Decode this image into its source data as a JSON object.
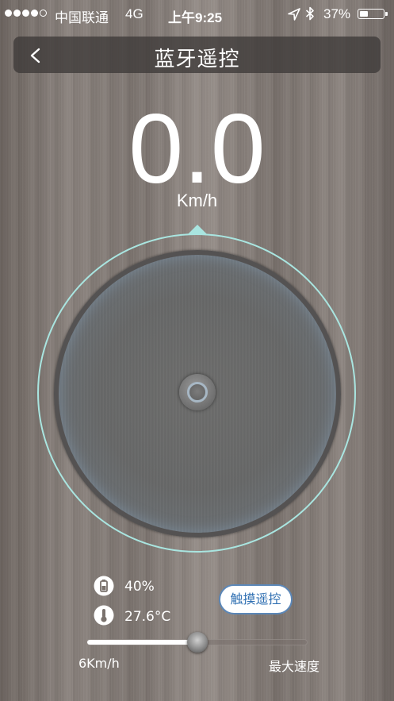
{
  "status_bar": {
    "carrier": "中国联通",
    "network": "4G",
    "time": "上午9:25",
    "battery_percent": "37%",
    "battery_level": 0.37,
    "signal_bars_filled": 4,
    "signal_bars_total": 5,
    "icons": [
      "location-arrow-icon",
      "bluetooth-icon",
      "battery-icon"
    ]
  },
  "header": {
    "title": "蓝牙遥控",
    "back_icon": "chevron-left-icon"
  },
  "speed": {
    "value": "0.0",
    "unit": "Km/h"
  },
  "joystick": {
    "ring_color": "#a9e5e0",
    "indicator_color": "#a9e5e0"
  },
  "info": {
    "battery": "40%",
    "temperature": "27.6°C",
    "battery_icon": "battery-icon",
    "temperature_icon": "thermometer-icon"
  },
  "touch_button": {
    "label": "触摸遥控",
    "text_color": "#2f6fb2"
  },
  "speed_slider": {
    "min_label": "6Km/h",
    "max_label": "最大速度",
    "level": 0.5
  }
}
